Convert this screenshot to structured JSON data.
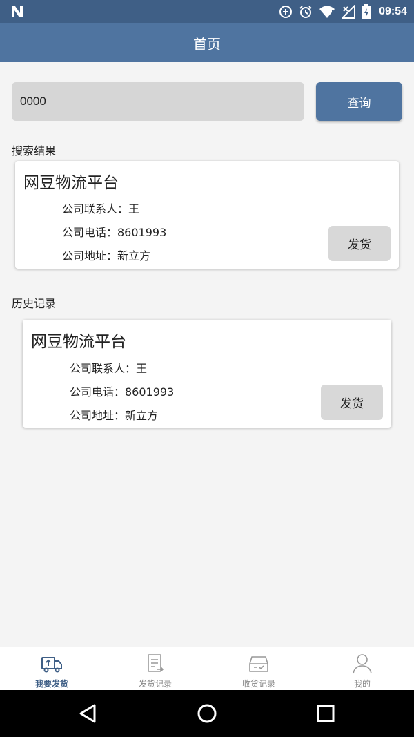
{
  "status_bar": {
    "time": "09:54"
  },
  "app_bar": {
    "title": "首页"
  },
  "search": {
    "value": "0000",
    "button_label": "查询"
  },
  "results_label": "搜索结果",
  "result_card": {
    "company_name": "网豆物流平台",
    "contact": "公司联系人：王",
    "phone": "公司电话：8601993",
    "address": "公司地址：新立方",
    "ship_label": "发货"
  },
  "history_label": "历史记录",
  "history_card": {
    "company_name": "网豆物流平台",
    "contact": "公司联系人：王",
    "phone": "公司电话：8601993",
    "address": "公司地址：新立方",
    "ship_label": "发货"
  },
  "bottom_nav": {
    "items": [
      {
        "label": "我要发货",
        "icon": "truck-icon",
        "active": true
      },
      {
        "label": "发货记录",
        "icon": "document-icon",
        "active": false
      },
      {
        "label": "收货记录",
        "icon": "inbox-icon",
        "active": false
      },
      {
        "label": "我的",
        "icon": "person-icon",
        "active": false
      }
    ]
  },
  "colors": {
    "status_bar": "#3f5f86",
    "primary": "#4f74a0",
    "active_nav": "#3f5f86",
    "background": "#f4f4f4"
  }
}
